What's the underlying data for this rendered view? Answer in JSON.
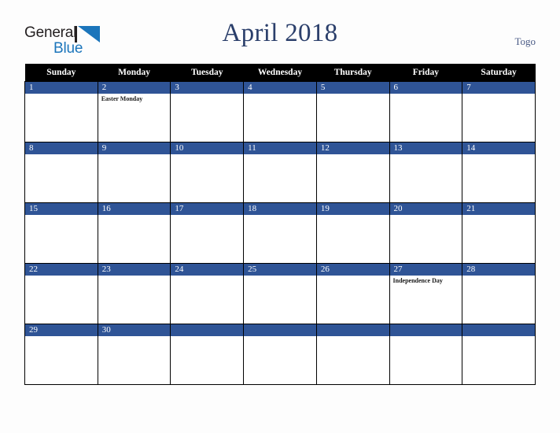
{
  "header": {
    "logo": {
      "text_primary": "General",
      "text_secondary": "Blue",
      "mark_icon": "blue-triangle-icon",
      "color_primary": "#231f20",
      "color_secondary": "#1b75bb"
    },
    "title": "April 2018",
    "country": "Togo"
  },
  "calendar": {
    "month": "April",
    "year": "2018",
    "accent_color": "#2f5496",
    "header_background": "#000000",
    "weekday_headers": [
      "Sunday",
      "Monday",
      "Tuesday",
      "Wednesday",
      "Thursday",
      "Friday",
      "Saturday"
    ],
    "weeks": [
      [
        {
          "day": "1",
          "holiday": ""
        },
        {
          "day": "2",
          "holiday": "Easter Monday"
        },
        {
          "day": "3",
          "holiday": ""
        },
        {
          "day": "4",
          "holiday": ""
        },
        {
          "day": "5",
          "holiday": ""
        },
        {
          "day": "6",
          "holiday": ""
        },
        {
          "day": "7",
          "holiday": ""
        }
      ],
      [
        {
          "day": "8",
          "holiday": ""
        },
        {
          "day": "9",
          "holiday": ""
        },
        {
          "day": "10",
          "holiday": ""
        },
        {
          "day": "11",
          "holiday": ""
        },
        {
          "day": "12",
          "holiday": ""
        },
        {
          "day": "13",
          "holiday": ""
        },
        {
          "day": "14",
          "holiday": ""
        }
      ],
      [
        {
          "day": "15",
          "holiday": ""
        },
        {
          "day": "16",
          "holiday": ""
        },
        {
          "day": "17",
          "holiday": ""
        },
        {
          "day": "18",
          "holiday": ""
        },
        {
          "day": "19",
          "holiday": ""
        },
        {
          "day": "20",
          "holiday": ""
        },
        {
          "day": "21",
          "holiday": ""
        }
      ],
      [
        {
          "day": "22",
          "holiday": ""
        },
        {
          "day": "23",
          "holiday": ""
        },
        {
          "day": "24",
          "holiday": ""
        },
        {
          "day": "25",
          "holiday": ""
        },
        {
          "day": "26",
          "holiday": ""
        },
        {
          "day": "27",
          "holiday": "Independence Day"
        },
        {
          "day": "28",
          "holiday": ""
        }
      ],
      [
        {
          "day": "29",
          "holiday": ""
        },
        {
          "day": "30",
          "holiday": ""
        },
        {
          "day": "",
          "holiday": ""
        },
        {
          "day": "",
          "holiday": ""
        },
        {
          "day": "",
          "holiday": ""
        },
        {
          "day": "",
          "holiday": ""
        },
        {
          "day": "",
          "holiday": ""
        }
      ]
    ]
  }
}
